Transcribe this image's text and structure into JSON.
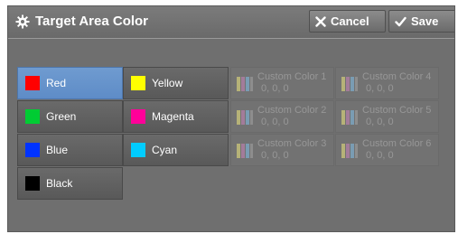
{
  "header": {
    "title": "Target Area Color",
    "cancel_label": "Cancel",
    "save_label": "Save"
  },
  "colors": [
    {
      "label": "Red",
      "color": "#ff0000",
      "selected": true
    },
    {
      "label": "Green",
      "color": "#00cc33"
    },
    {
      "label": "Blue",
      "color": "#0033ff"
    },
    {
      "label": "Black",
      "color": "#000000"
    },
    {
      "label": "Yellow",
      "color": "#ffff00"
    },
    {
      "label": "Magenta",
      "color": "#ff0099"
    },
    {
      "label": "Cyan",
      "color": "#00ccff"
    }
  ],
  "custom_colors": [
    {
      "name": "Custom Color 1",
      "value": "0,  0,  0"
    },
    {
      "name": "Custom Color 2",
      "value": "0,  0,  0"
    },
    {
      "name": "Custom Color 3",
      "value": "0,  0,  0"
    },
    {
      "name": "Custom Color 4",
      "value": "0,  0,  0"
    },
    {
      "name": "Custom Color 5",
      "value": "0,  0,  0"
    },
    {
      "name": "Custom Color 6",
      "value": "0,  0,  0"
    }
  ],
  "accent_color": "#6f9bd0"
}
